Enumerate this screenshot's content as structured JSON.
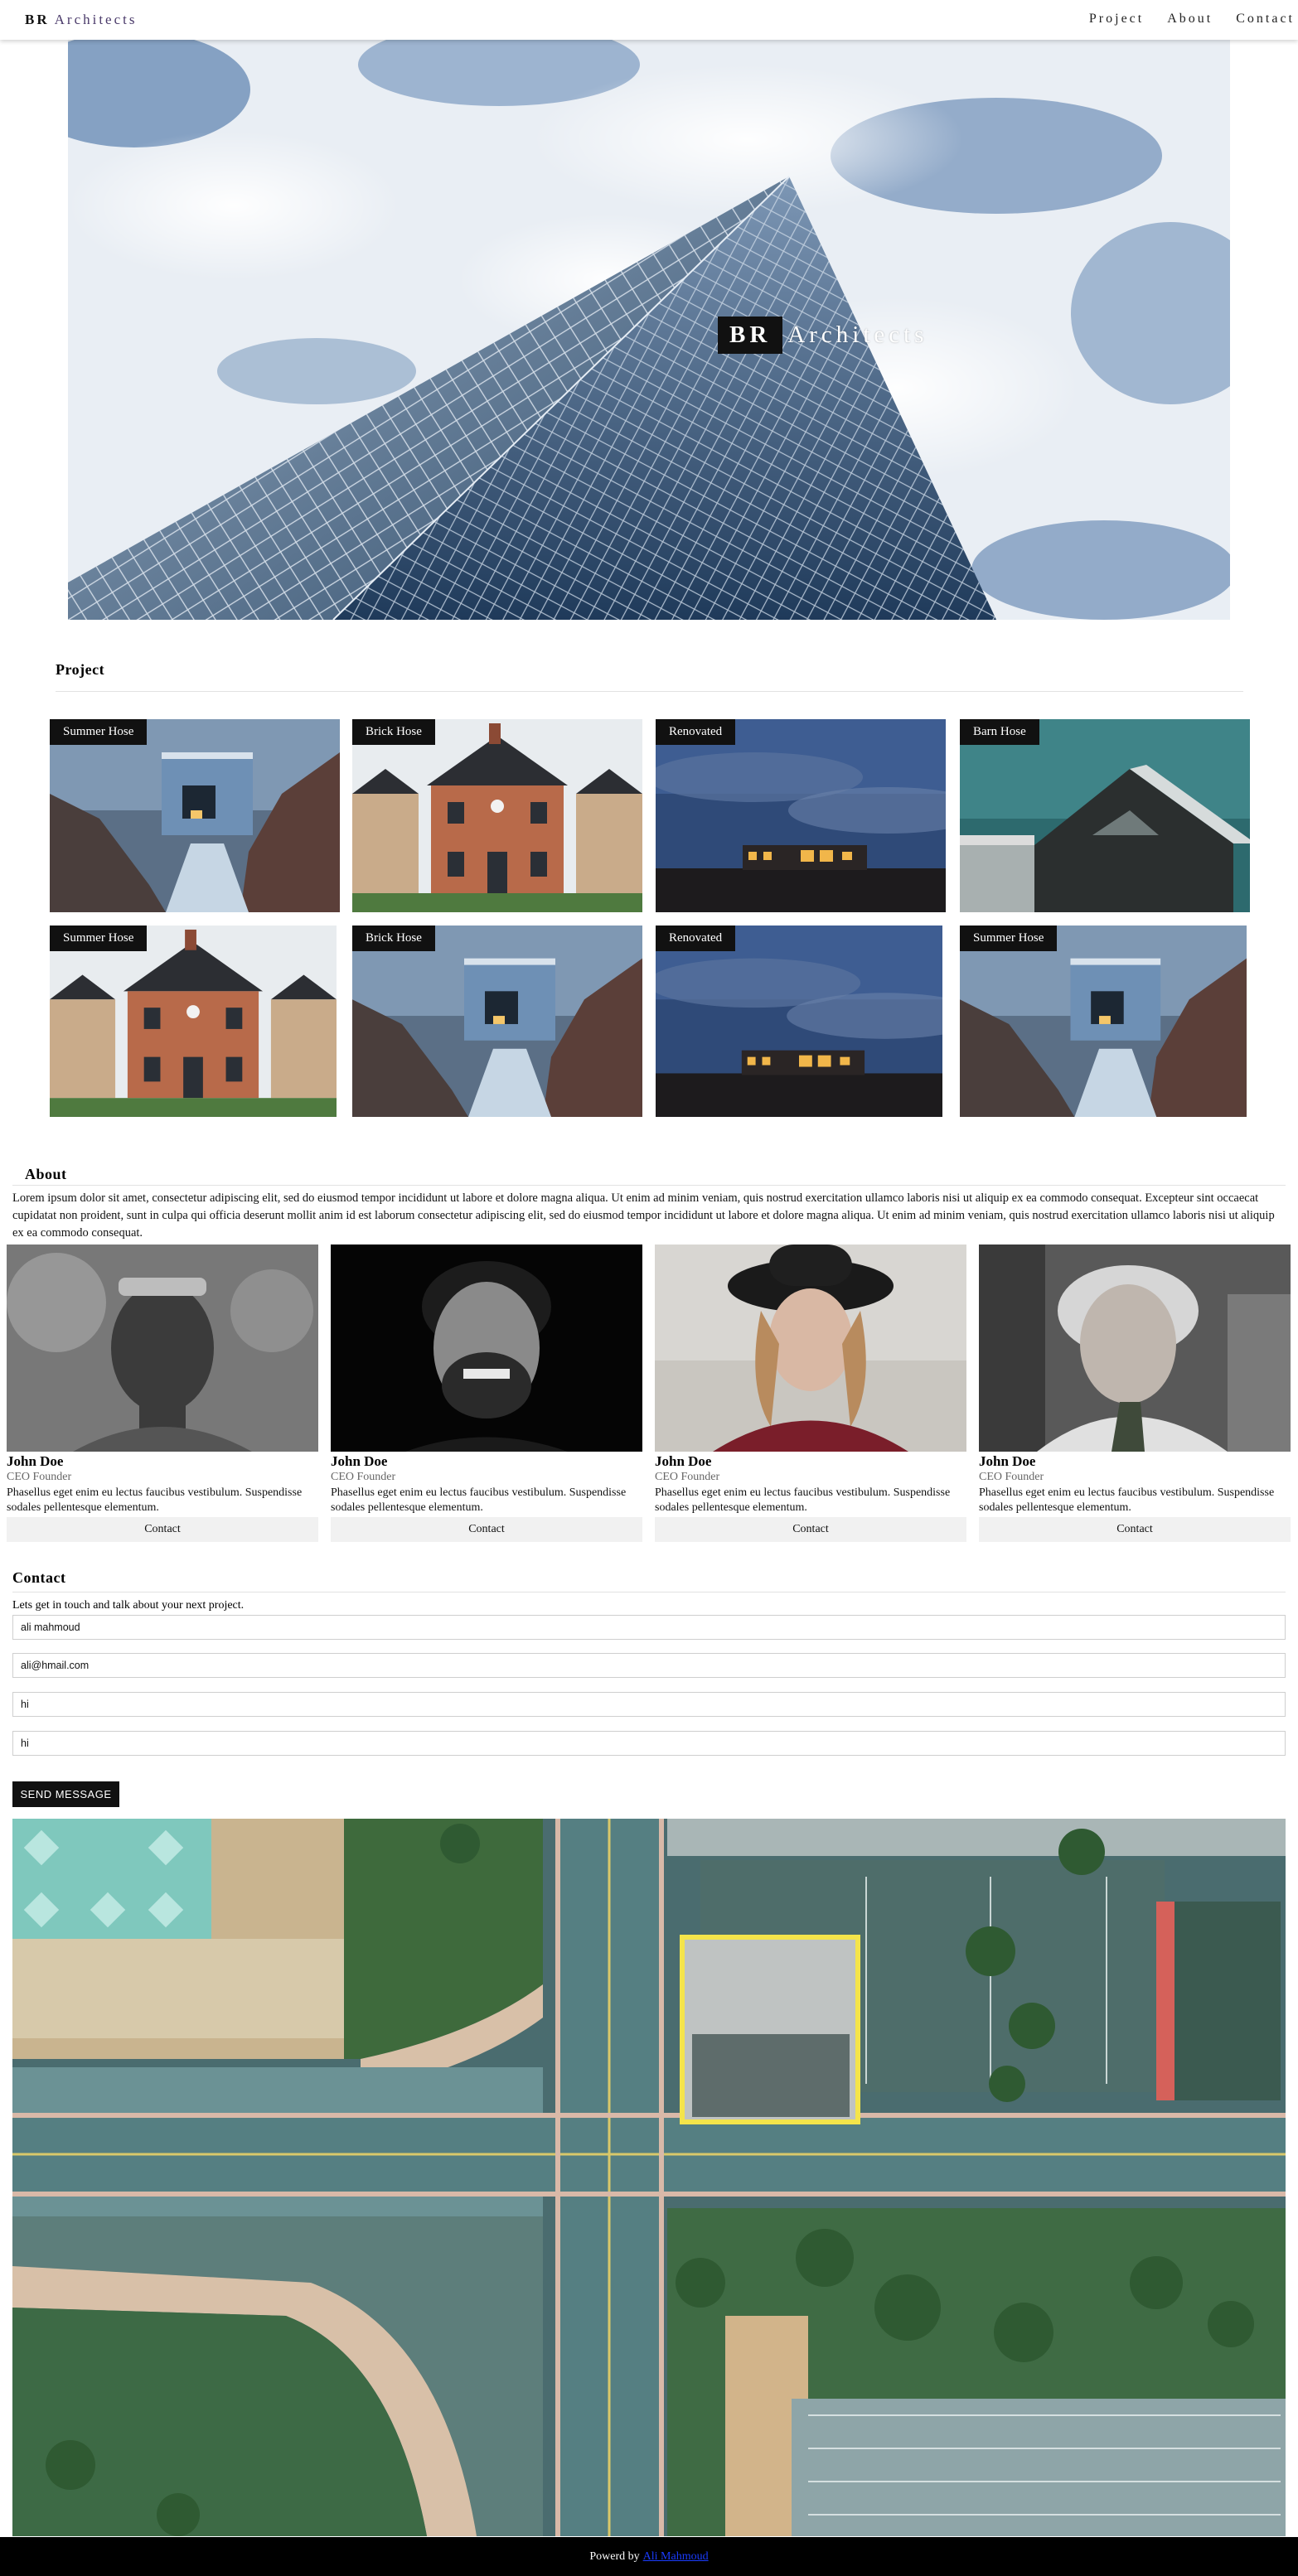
{
  "header": {
    "brand_bold": "BR",
    "brand_rest": "Architects",
    "nav": [
      "Project",
      "About",
      "Contact"
    ]
  },
  "hero": {
    "title_bold": "BR",
    "title_rest": "Architects"
  },
  "projects": {
    "heading": "Project",
    "tiles": [
      {
        "label": "Summer Hose",
        "scene": "blue-house"
      },
      {
        "label": "Brick Hose",
        "scene": "brick-house"
      },
      {
        "label": "Renovated",
        "scene": "dusk-house"
      },
      {
        "label": "Barn Hose",
        "scene": "barn-house"
      },
      {
        "label": "Summer Hose",
        "scene": "brick-house"
      },
      {
        "label": "Brick Hose",
        "scene": "blue-house"
      },
      {
        "label": "Renovated",
        "scene": "dusk-house"
      },
      {
        "label": "Summer Hose",
        "scene": "blue-house"
      }
    ]
  },
  "about": {
    "heading": "About",
    "text": "Lorem ipsum dolor sit amet, consectetur adipiscing elit, sed do eiusmod tempor incididunt ut labore et dolore magna aliqua. Ut enim ad minim veniam, quis nostrud exercitation ullamco laboris nisi ut aliquip ex ea commodo consequat. Excepteur sint occaecat cupidatat non proident, sunt in culpa qui officia deserunt mollit anim id est laborum consectetur adipiscing elit, sed do eiusmod tempor incididunt ut labore et dolore magna aliqua. Ut enim ad minim veniam, quis nostrud exercitation ullamco laboris nisi ut aliquip ex ea commodo consequat.",
    "team": [
      {
        "name": "John Doe",
        "role": "CEO Founder",
        "desc": "Phasellus eget enim eu lectus faucibus vestibulum. Suspendisse sodales pellentesque elementum.",
        "button": "Contact"
      },
      {
        "name": "John Doe",
        "role": "CEO Founder",
        "desc": "Phasellus eget enim eu lectus faucibus vestibulum. Suspendisse sodales pellentesque elementum.",
        "button": "Contact"
      },
      {
        "name": "John Doe",
        "role": "CEO Founder",
        "desc": "Phasellus eget enim eu lectus faucibus vestibulum. Suspendisse sodales pellentesque elementum.",
        "button": "Contact"
      },
      {
        "name": "John Doe",
        "role": "CEO Founder",
        "desc": "Phasellus eget enim eu lectus faucibus vestibulum. Suspendisse sodales pellentesque elementum.",
        "button": "Contact"
      }
    ]
  },
  "contact": {
    "heading": "Contact",
    "subtitle": "Lets get in touch and talk about your next project.",
    "fields": {
      "name": "ali mahmoud",
      "email": "ali@hmail.com",
      "subject": "hi",
      "comment": "hi"
    },
    "send_label": "SEND MESSAGE"
  },
  "footer": {
    "text": "Powerd by",
    "link": "Ali Mahmoud"
  }
}
